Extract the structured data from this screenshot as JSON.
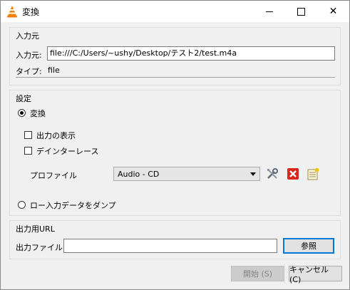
{
  "window": {
    "title": "変換"
  },
  "source": {
    "group_title": "入力元",
    "source_label": "入力元:",
    "source_value": "file:///C:/Users/~ushy/Desktop/テスト2/test.m4a",
    "type_label": "タイプ:",
    "type_value": "file"
  },
  "settings": {
    "group_title": "設定",
    "convert_label": "変換",
    "show_output_label": "出力の表示",
    "deinterlace_label": "デインターレース",
    "profile_label": "プロファイル",
    "profile_value": "Audio - CD",
    "raw_dump_label": "ロー入力データをダンプ"
  },
  "destination": {
    "group_title": "出力用URL",
    "file_label": "出力ファイル:",
    "file_value": "",
    "browse_label": "参照"
  },
  "footer": {
    "start_label": "開始 (S)",
    "cancel_label": "キャンセル (C)"
  }
}
